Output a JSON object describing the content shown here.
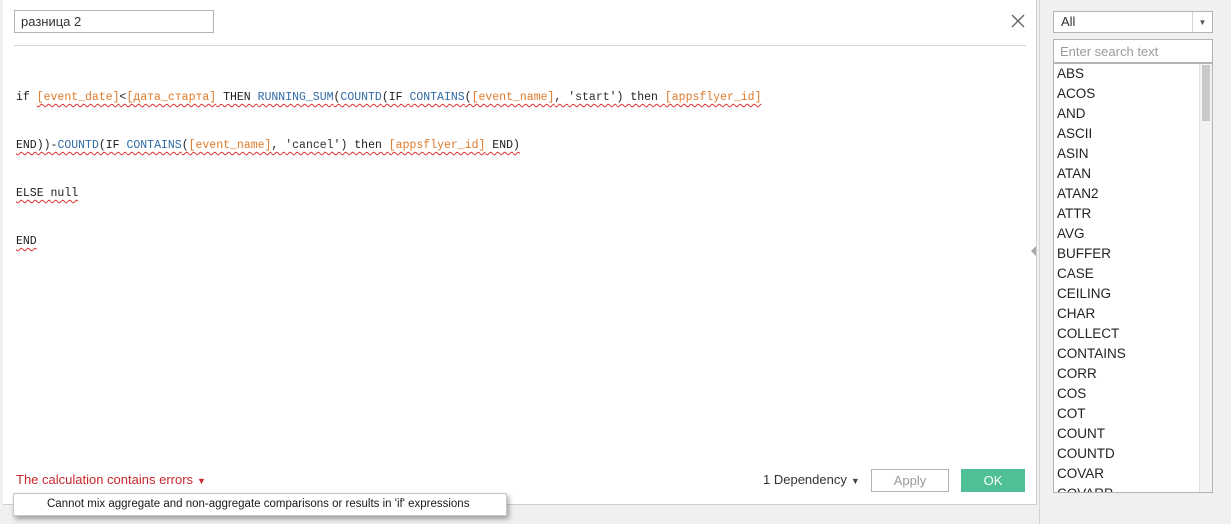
{
  "dialog": {
    "calc_name": "разница 2",
    "close_icon": "close-icon"
  },
  "formula": {
    "line1": [
      "if ",
      "[event_date]",
      "<",
      "[дата_старта]",
      " THEN ",
      "RUNNING_SUM",
      "(",
      "COUNTD",
      "(IF ",
      "CONTAINS",
      "(",
      "[event_name]",
      ", ",
      "'start'",
      ") ",
      "then ",
      "[appsflyer_id]"
    ],
    "line2": [
      "END",
      "))-",
      "COUNTD",
      "(IF ",
      "CONTAINS",
      "(",
      "[event_name]",
      ", ",
      "'cancel'",
      ") ",
      "then ",
      "[appsflyer_id]",
      " END",
      ")"
    ],
    "line3": [
      "ELSE ",
      "null"
    ],
    "line4": [
      "END"
    ]
  },
  "footer": {
    "error_text": "The calculation contains errors",
    "dependency_text": "1 Dependency",
    "apply_label": "Apply",
    "ok_label": "OK",
    "error_message": "Cannot mix aggregate and non-aggregate comparisons or results in 'if' expressions"
  },
  "functions_panel": {
    "category_selected": "All",
    "search_placeholder": "Enter search text",
    "items": [
      "ABS",
      "ACOS",
      "AND",
      "ASCII",
      "ASIN",
      "ATAN",
      "ATAN2",
      "ATTR",
      "AVG",
      "BUFFER",
      "CASE",
      "CEILING",
      "CHAR",
      "COLLECT",
      "CONTAINS",
      "CORR",
      "COS",
      "COT",
      "COUNT",
      "COUNTD",
      "COVAR",
      "COVARP"
    ]
  },
  "colors": {
    "error_red": "#c8282d",
    "ok_green": "#4fc095",
    "field_orange": "#e07a2a",
    "function_blue": "#2f6aa6"
  }
}
